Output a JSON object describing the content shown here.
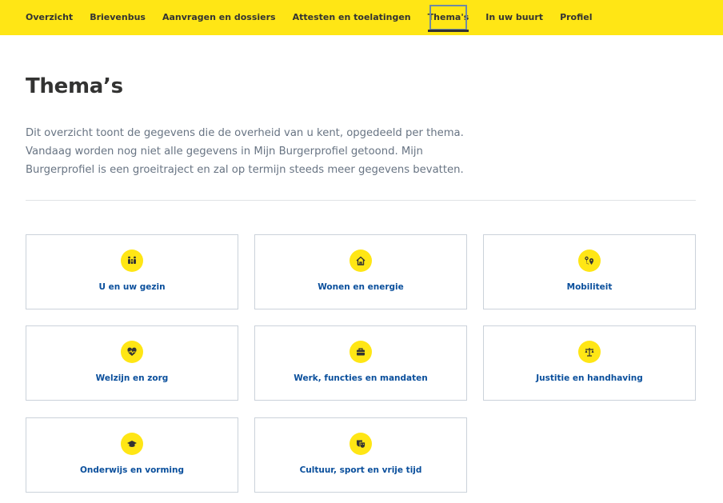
{
  "nav": {
    "items": [
      {
        "label": "Overzicht"
      },
      {
        "label": "Brievenbus"
      },
      {
        "label": "Aanvragen en dossiers"
      },
      {
        "label": "Attesten en toelatingen"
      },
      {
        "label": "Thema's",
        "active": true
      },
      {
        "label": "In uw buurt"
      },
      {
        "label": "Profiel"
      }
    ]
  },
  "page": {
    "title": "Thema’s",
    "intro": [
      "Dit overzicht toont de gegevens die de overheid van u kent, opgedeeld per thema.",
      "Vandaag worden nog niet alle gegevens in Mijn Burgerprofiel getoond. Mijn",
      "Burgerprofiel is een groeitraject en zal op termijn steeds meer gegevens bevatten."
    ]
  },
  "themes": [
    {
      "label": "U en uw gezin",
      "icon": "family-icon"
    },
    {
      "label": "Wonen en energie",
      "icon": "house-icon"
    },
    {
      "label": "Mobiliteit",
      "icon": "route-pin-icon"
    },
    {
      "label": "Welzijn en zorg",
      "icon": "heart-pulse-icon"
    },
    {
      "label": "Werk, functies en mandaten",
      "icon": "briefcase-icon"
    },
    {
      "label": "Justitie en handhaving",
      "icon": "scales-icon"
    },
    {
      "label": "Onderwijs en vorming",
      "icon": "graduation-cap-icon"
    },
    {
      "label": "Cultuur, sport en vrije tijd",
      "icon": "theater-masks-icon"
    }
  ],
  "colors": {
    "accent": "#ffe615",
    "link": "#0a4f9c",
    "text": "#333332",
    "muted": "#687483",
    "border": "#cbd2da"
  }
}
